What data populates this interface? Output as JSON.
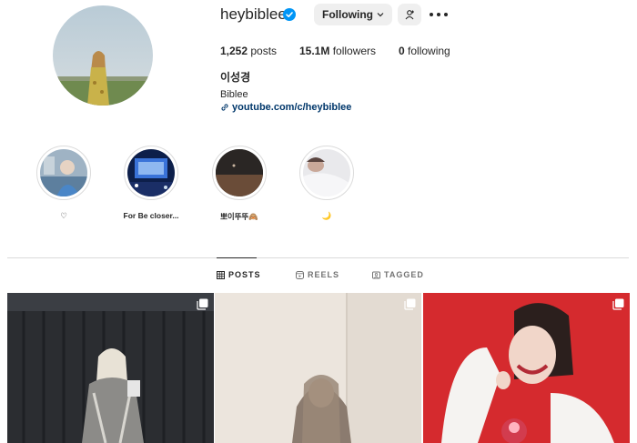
{
  "profile": {
    "username": "heybiblee",
    "verified": true,
    "following_label": "Following",
    "stats": {
      "posts_count": "1,252",
      "posts_label": "posts",
      "followers_count": "15.1M",
      "followers_label": "followers",
      "following_count": "0",
      "following_label": "following"
    },
    "full_name": "이성경",
    "bio": "Biblee",
    "link": "youtube.com/c/heybiblee"
  },
  "highlights": [
    {
      "label": "♡"
    },
    {
      "label": "For Be closer..."
    },
    {
      "label": "뽀이뚜뚜🙈"
    },
    {
      "label": "🌙"
    }
  ],
  "tabs": [
    {
      "label": "POSTS",
      "icon": "grid-icon",
      "active": true
    },
    {
      "label": "REELS",
      "icon": "reels-icon",
      "active": false
    },
    {
      "label": "TAGGED",
      "icon": "tagged-icon",
      "active": false
    }
  ],
  "colors": {
    "verified_blue": "#0095f6",
    "link_blue": "#00376b",
    "button_gray": "#efefef",
    "divider": "#dbdbdb"
  }
}
